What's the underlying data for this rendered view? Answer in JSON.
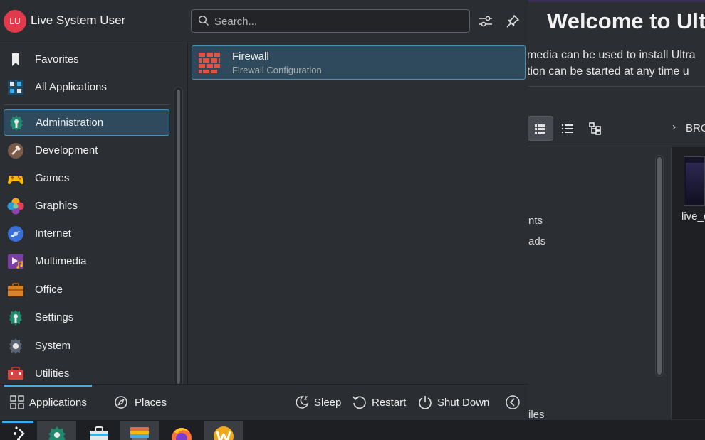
{
  "background_window": {
    "title": "Welcome to Ult",
    "line1": "media can be used to install Ultra",
    "line2": "tion can be started at any time u",
    "breadcrumb": "BRO",
    "sidebar_items": [
      "nts",
      "ads",
      "iles"
    ],
    "file_label": "live_c"
  },
  "launcher": {
    "user": {
      "initials": "LU",
      "name": "Live System User"
    },
    "search": {
      "placeholder": "Search..."
    },
    "categories": [
      {
        "label": "Favorites",
        "icon": "bookmark-icon"
      },
      {
        "label": "All Applications",
        "icon": "all-applications-icon"
      },
      {
        "label": "Administration",
        "icon": "administration-icon"
      },
      {
        "label": "Development",
        "icon": "development-icon"
      },
      {
        "label": "Games",
        "icon": "games-icon"
      },
      {
        "label": "Graphics",
        "icon": "graphics-icon"
      },
      {
        "label": "Internet",
        "icon": "internet-icon"
      },
      {
        "label": "Multimedia",
        "icon": "multimedia-icon"
      },
      {
        "label": "Office",
        "icon": "office-icon"
      },
      {
        "label": "Settings",
        "icon": "settings-icon"
      },
      {
        "label": "System",
        "icon": "system-icon"
      },
      {
        "label": "Utilities",
        "icon": "utilities-icon"
      }
    ],
    "selected_category": "Administration",
    "apps": [
      {
        "name": "Firewall",
        "description": "Firewall Configuration",
        "icon": "firewall-icon"
      }
    ],
    "footer": {
      "tabs": [
        {
          "label": "Applications",
          "icon": "applications-grid-icon",
          "active": true
        },
        {
          "label": "Places",
          "icon": "places-compass-icon",
          "active": false
        }
      ],
      "actions": [
        {
          "label": "Sleep",
          "icon": "sleep-icon"
        },
        {
          "label": "Restart",
          "icon": "restart-icon"
        },
        {
          "label": "Shut Down",
          "icon": "power-icon"
        }
      ]
    }
  },
  "taskbar": {
    "items": [
      "launcher-icon",
      "discover-icon",
      "store-icon",
      "files-icon",
      "firefox-icon",
      "welcome-app-icon"
    ]
  },
  "colors": {
    "accent": "#3daee9",
    "selection_bg": "#2e4a5c",
    "avatar": "#e03a4c"
  }
}
